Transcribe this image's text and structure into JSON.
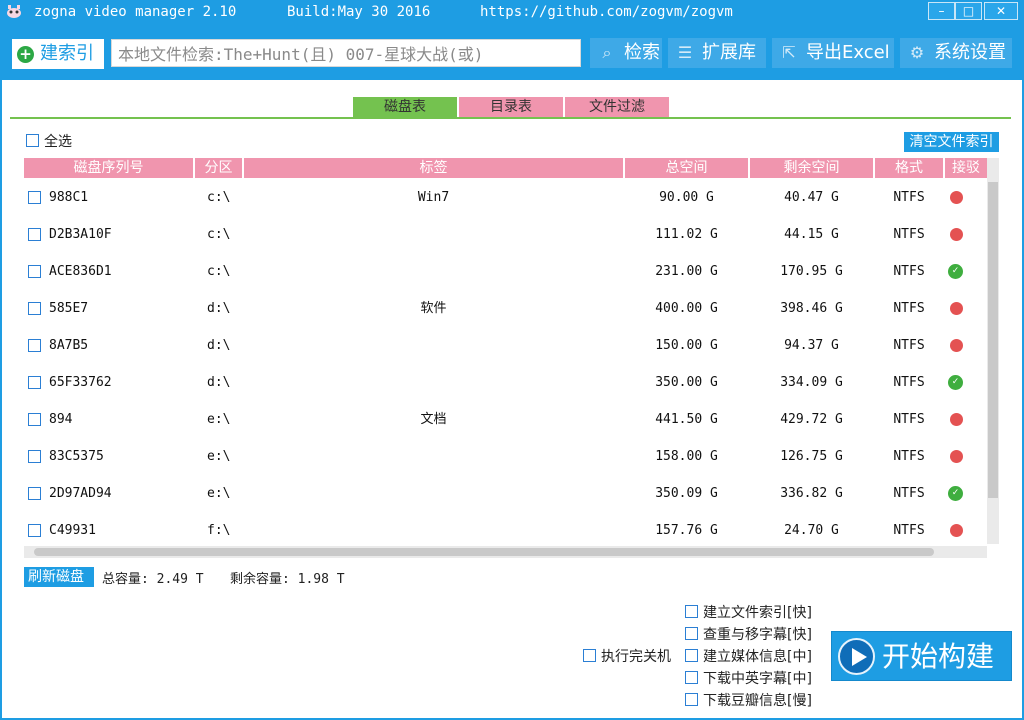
{
  "titlebar": {
    "app_name": "zogna video manager 2.10",
    "build": "Build:May 30 2016",
    "url": "https://github.com/zogvm/zogvm",
    "minimize": "–",
    "maximize": "□",
    "close": "✕"
  },
  "toolbar": {
    "index_label": "建索引",
    "search_value": "本地文件检索:The+Hunt(且) 007-星球大战(或)",
    "search_label": "检索",
    "extend_label": "扩展库",
    "export_label": "导出Excel",
    "settings_label": "系统设置"
  },
  "tabs": [
    {
      "label": "磁盘表",
      "active": true
    },
    {
      "label": "目录表",
      "active": false
    },
    {
      "label": "文件过滤",
      "active": false
    }
  ],
  "select_all_label": "全选",
  "clear_index_label": "清空文件索引",
  "columns": [
    "磁盘序列号",
    "分区",
    "标签",
    "总空间",
    "剩余空间",
    "格式",
    "接驳"
  ],
  "disks": [
    {
      "serial": "988C1",
      "partition": "c:\\",
      "label": "Win7",
      "total": "90.00 G",
      "free": "40.47 G",
      "format": "NTFS",
      "status": "red"
    },
    {
      "serial": "D2B3A10F",
      "partition": "c:\\",
      "label": "",
      "total": "111.02 G",
      "free": "44.15 G",
      "format": "NTFS",
      "status": "red"
    },
    {
      "serial": "ACE836D1",
      "partition": "c:\\",
      "label": "",
      "total": "231.00 G",
      "free": "170.95 G",
      "format": "NTFS",
      "status": "green"
    },
    {
      "serial": "585E7",
      "partition": "d:\\",
      "label": "软件",
      "total": "400.00 G",
      "free": "398.46 G",
      "format": "NTFS",
      "status": "red"
    },
    {
      "serial": "8A7B5",
      "partition": "d:\\",
      "label": "",
      "total": "150.00 G",
      "free": "94.37 G",
      "format": "NTFS",
      "status": "red"
    },
    {
      "serial": "65F33762",
      "partition": "d:\\",
      "label": "",
      "total": "350.00 G",
      "free": "334.09 G",
      "format": "NTFS",
      "status": "green"
    },
    {
      "serial": "894",
      "partition": "e:\\",
      "label": "文档",
      "total": "441.50 G",
      "free": "429.72 G",
      "format": "NTFS",
      "status": "red"
    },
    {
      "serial": "83C5375",
      "partition": "e:\\",
      "label": "",
      "total": "158.00 G",
      "free": "126.75 G",
      "format": "NTFS",
      "status": "red"
    },
    {
      "serial": "2D97AD94",
      "partition": "e:\\",
      "label": "",
      "total": "350.09 G",
      "free": "336.82 G",
      "format": "NTFS",
      "status": "green"
    },
    {
      "serial": "C49931",
      "partition": "f:\\",
      "label": "",
      "total": "157.76 G",
      "free": "24.70 G",
      "format": "NTFS",
      "status": "red"
    }
  ],
  "footer": {
    "refresh_label": "刷新磁盘",
    "total_capacity": "总容量: 2.49 T",
    "free_capacity": "剩余容量: 1.98 T"
  },
  "shutdown_label": "执行完关机",
  "build_options": [
    "建立文件索引[快]",
    "查重与移字幕[快]",
    "建立媒体信息[中]",
    "下载中英字幕[中]",
    "下载豆瓣信息[慢]"
  ],
  "start_label": "开始构建",
  "colors": {
    "primary": "#1e9de3",
    "header_pink": "#f095ae",
    "tab_active": "#74c24f",
    "status_red": "#e45252",
    "status_green": "#3fae3f"
  }
}
